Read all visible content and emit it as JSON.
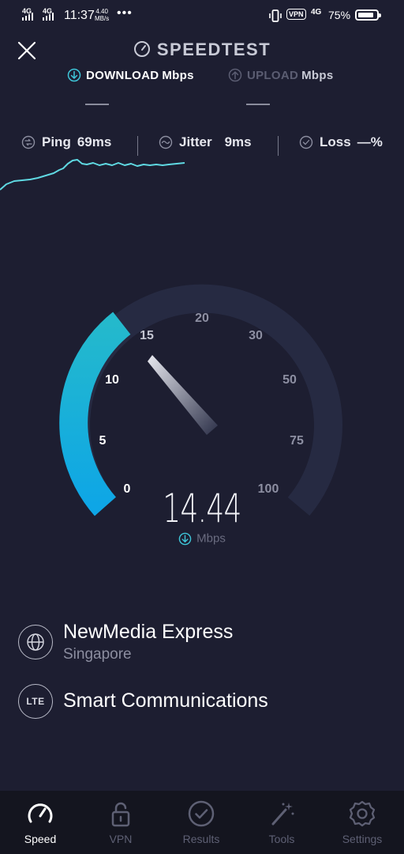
{
  "status_bar": {
    "signal1": "4G",
    "signal2": "4G",
    "time": "11:37",
    "net_speed_value": "4.40",
    "net_speed_unit": "MB/s",
    "more": "•••",
    "vpn": "VPN",
    "lte": "4G",
    "battery": "75%"
  },
  "header": {
    "title": "SPEEDTEST",
    "download_label": "DOWNLOAD",
    "download_unit": "Mbps",
    "upload_label": "UPLOAD",
    "upload_unit": "Mbps"
  },
  "metrics": {
    "ping_label": "Ping",
    "ping_value": "69ms",
    "jitter_label": "Jitter",
    "jitter_value": "9ms",
    "loss_label": "Loss",
    "loss_value": "—%"
  },
  "gauge": {
    "ticks": [
      "0",
      "5",
      "10",
      "15",
      "20",
      "30",
      "50",
      "75",
      "100"
    ],
    "current_speed": "14.44",
    "unit": "Mbps",
    "accent_color": "#16b7e3",
    "track_color": "#262a42"
  },
  "server": {
    "host": "NewMedia Express",
    "location": "Singapore",
    "isp_badge": "LTE",
    "isp": "Smart Communications"
  },
  "nav": {
    "items": [
      {
        "label": "Speed",
        "icon": "speedometer-icon",
        "active": true
      },
      {
        "label": "VPN",
        "icon": "lock-icon",
        "active": false
      },
      {
        "label": "Results",
        "icon": "check-circle-icon",
        "active": false
      },
      {
        "label": "Tools",
        "icon": "magic-wand-icon",
        "active": false
      },
      {
        "label": "Settings",
        "icon": "gear-icon",
        "active": false
      }
    ]
  }
}
